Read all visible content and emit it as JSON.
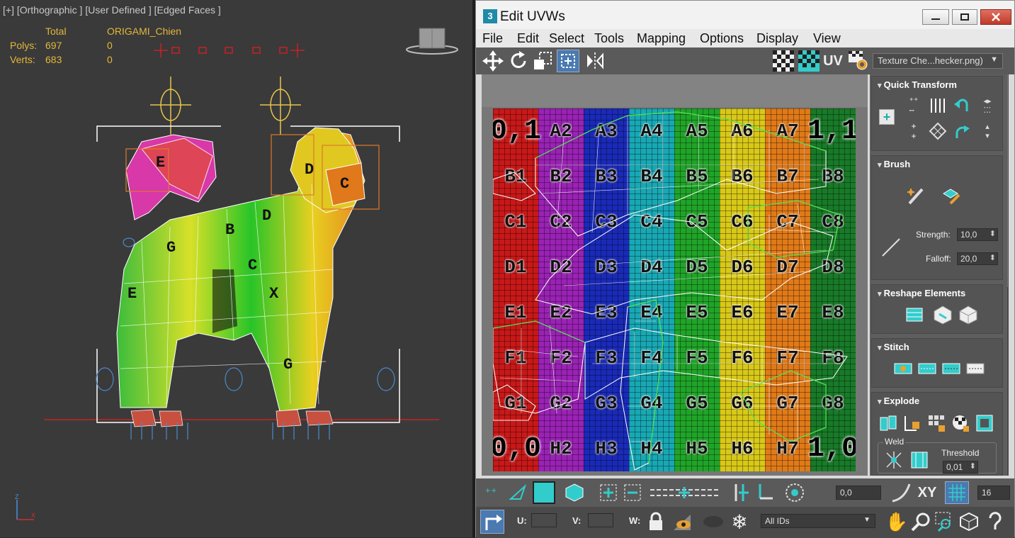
{
  "viewport": {
    "label": "[+] [Orthographic ] [User Defined ] [Edged Faces ]",
    "stats": {
      "header_total": "Total",
      "header_object": "ORIGAMI_Chien",
      "polys_label": "Polys:",
      "polys_total": "697",
      "polys_object": "0",
      "verts_label": "Verts:",
      "verts_total": "683",
      "verts_object": "0"
    },
    "colors": {
      "bg": "#3a3a3a",
      "stats": "#e3b83a",
      "gizmo": "#e7c44a",
      "ground": "#cc2222"
    }
  },
  "uvw": {
    "title": "Edit UVWs",
    "app_icon": "3",
    "menu": [
      "File",
      "Edit",
      "Select",
      "Tools",
      "Mapping",
      "Options",
      "Display",
      "View"
    ],
    "toolbar": {
      "uv_label": "UV",
      "texture_dropdown": "Texture Che...hecker.png)",
      "icons": [
        "move-icon",
        "rotate-icon",
        "scale-icon",
        "freeform-icon",
        "mirror-icon",
        "checker-icon",
        "checker-teal-icon",
        "uv-icon",
        "settings-icon"
      ]
    },
    "checker": {
      "columns": [
        "#c81818",
        "#9a22b4",
        "#1a2ab8",
        "#18a8b4",
        "#20a428",
        "#d8c818",
        "#e07a18",
        "#187a28"
      ],
      "rows": [
        [
          "0,1",
          "A2",
          "A3",
          "A4",
          "A5",
          "A6",
          "A7",
          "1,1"
        ],
        [
          "B1",
          "B2",
          "B3",
          "B4",
          "B5",
          "B6",
          "B7",
          "B8"
        ],
        [
          "C1",
          "C2",
          "C3",
          "C4",
          "C5",
          "C6",
          "C7",
          "C8"
        ],
        [
          "D1",
          "D2",
          "D3",
          "D4",
          "D5",
          "D6",
          "D7",
          "D8"
        ],
        [
          "E1",
          "E2",
          "E3",
          "E4",
          "E5",
          "E6",
          "E7",
          "E8"
        ],
        [
          "F1",
          "F2",
          "F3",
          "F4",
          "F5",
          "F6",
          "F7",
          "F8"
        ],
        [
          "G1",
          "G2",
          "G3",
          "G4",
          "G5",
          "G6",
          "G7",
          "G8"
        ],
        [
          "0,0",
          "H2",
          "H3",
          "H4",
          "H5",
          "H6",
          "H7",
          "1,0"
        ]
      ]
    },
    "panels": {
      "quick_transform": "Quick Transform",
      "brush": "Brush",
      "strength_label": "Strength:",
      "strength_value": "10,0",
      "falloff_label": "Falloff:",
      "falloff_value": "20,0",
      "reshape": "Reshape Elements",
      "stitch": "Stitch",
      "explode": "Explode",
      "weld": "Weld",
      "threshold_label": "Threshold",
      "threshold_value": "0,01"
    },
    "bottom": {
      "soft_value": "0,0",
      "xy_label": "XY",
      "grid_value": "16",
      "u_label": "U:",
      "v_label": "V:",
      "w_label": "W:",
      "ids_dropdown": "All IDs"
    }
  }
}
